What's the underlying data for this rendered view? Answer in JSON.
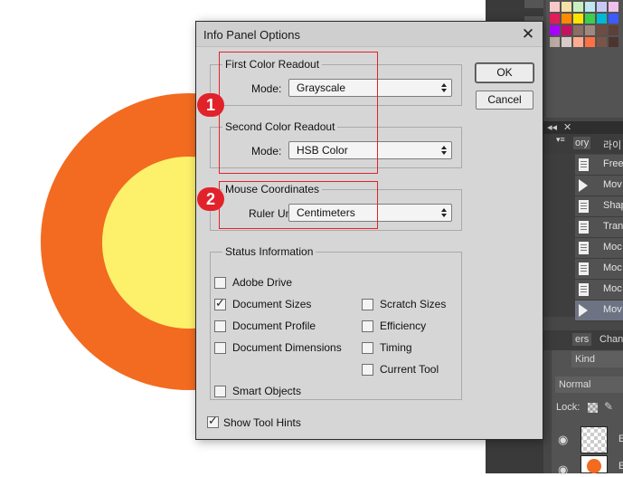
{
  "dialog": {
    "title": "Info Panel Options",
    "ok_label": "OK",
    "cancel_label": "Cancel",
    "first_color": {
      "legend": "First Color Readout",
      "mode_label": "Mode:",
      "mode_value": "Grayscale"
    },
    "second_color": {
      "legend": "Second Color Readout",
      "mode_label": "Mode:",
      "mode_value": "HSB Color"
    },
    "mouse": {
      "legend": "Mouse Coordinates",
      "units_label": "Ruler Units:",
      "units_value": "Centimeters"
    },
    "status": {
      "legend": "Status Information",
      "items": [
        {
          "label": "Adobe Drive",
          "checked": false
        },
        {
          "label": "Document Sizes",
          "checked": true
        },
        {
          "label": "Document Profile",
          "checked": false
        },
        {
          "label": "Document Dimensions",
          "checked": false
        },
        {
          "label": "Scratch Sizes",
          "checked": false
        },
        {
          "label": "Efficiency",
          "checked": false
        },
        {
          "label": "Timing",
          "checked": false
        },
        {
          "label": "Current Tool",
          "checked": false
        },
        {
          "label": "Smart Objects",
          "checked": false
        }
      ]
    },
    "show_tool_hints": {
      "label": "Show Tool Hints",
      "checked": true
    }
  },
  "annotations": {
    "badge1": "1",
    "badge2": "2"
  },
  "photoshop": {
    "history_tab": "ory",
    "history_tab2": "라이",
    "history_items": [
      "Free",
      "Mov",
      "Shap",
      "Tran",
      "Moc",
      "Moc",
      "Moc",
      "Mov"
    ],
    "layers_tab": "ers",
    "channels_tab": "Chan",
    "kind_filter": "Kind",
    "blend_mode": "Normal",
    "lock_label": "Lock:",
    "layer_label_1": "E",
    "layer_label_2": "E"
  },
  "colors": {
    "outer_circle": "#f26b21",
    "inner_circle": "#fdf16b",
    "annotation_red": "#e2222a",
    "dialog_bg": "#d6d6d6"
  },
  "icons": {
    "close": "close-icon",
    "checkmark": "checkmark-icon",
    "dropdown": "chevron-updown-icon"
  }
}
